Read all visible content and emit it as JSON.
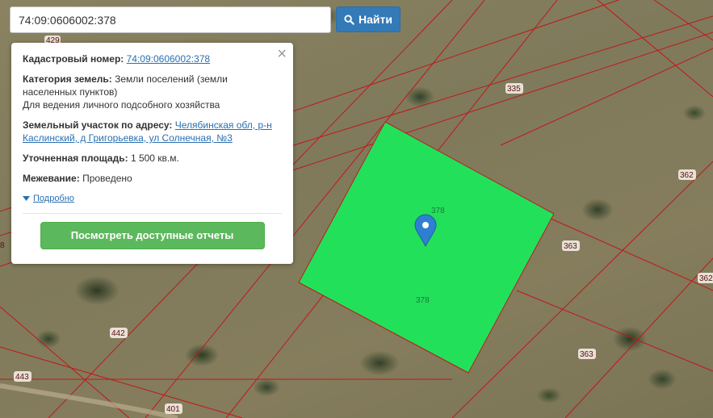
{
  "search": {
    "value": "74:09:0606002:378",
    "button_label": "Найти"
  },
  "popup": {
    "cadastral_label": "Кадастровый номер:",
    "cadastral_value": "74:09:0606002:378",
    "category_label": "Категория земель:",
    "category_value_1": "Земли поселений (земли",
    "category_value_2": "населенных пунктов)",
    "category_value_3": "Для ведения личного подсобного хозяйства",
    "address_label": "Земельный участок по адресу:",
    "address_value_1": "Челябинская обл, р-н",
    "address_value_2": "Каслинский, д Григорьевка, ул Солнечная, №3",
    "area_label": "Уточненная площадь:",
    "area_value": "1 500 кв.м.",
    "survey_label": "Межевание:",
    "survey_value": "Проведено",
    "more_label": "Подробно",
    "report_button": "Посмотреть доступные отчеты",
    "close_icon": "close-icon"
  },
  "map": {
    "parcel_color": "#1ee65a",
    "boundary_color": "#c0171b",
    "marker_color": "#2f7fd1",
    "parcel_labels": [
      "429",
      "335",
      "362",
      "378",
      "378",
      "363",
      "363",
      "362",
      "442",
      "443",
      "401",
      "8"
    ]
  }
}
